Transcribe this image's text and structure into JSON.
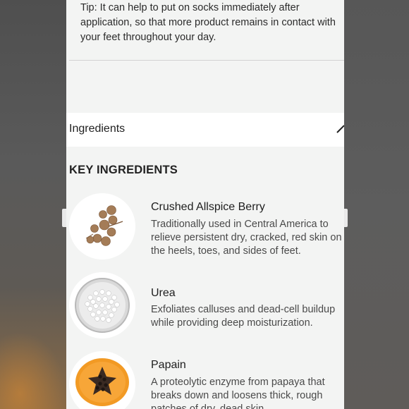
{
  "tip": {
    "text": "Tip: It can help to put on socks immediately after application, so that more product remains in contact with your feet throughout your day."
  },
  "ingredients_section": {
    "label": "Ingredients",
    "edit_icon": "pencil-icon"
  },
  "key_ingredients": {
    "title": "KEY INGREDIENTS",
    "items": [
      {
        "name": "Crushed Allspice Berry",
        "description": "Traditionally used in Central America to relieve persistent dry, cracked, red skin on the heels, toes, and sides of feet.",
        "image": "allspice-berries-image"
      },
      {
        "name": "Urea",
        "description": "Exfoliates calluses and dead-cell buildup while providing deep moisturization.",
        "image": "urea-pearls-dish-image"
      },
      {
        "name": "Papain",
        "description": "A proteolytic enzyme from papaya that breaks down and loosens thick, rough patches of dry, dead skin.",
        "image": "papaya-half-image"
      }
    ]
  },
  "colors": {
    "panel_background": "#f3f4f3",
    "outer_background": "#5b5b5b",
    "text_primary": "#1e1e1e",
    "text_secondary": "#4a4a4a"
  }
}
